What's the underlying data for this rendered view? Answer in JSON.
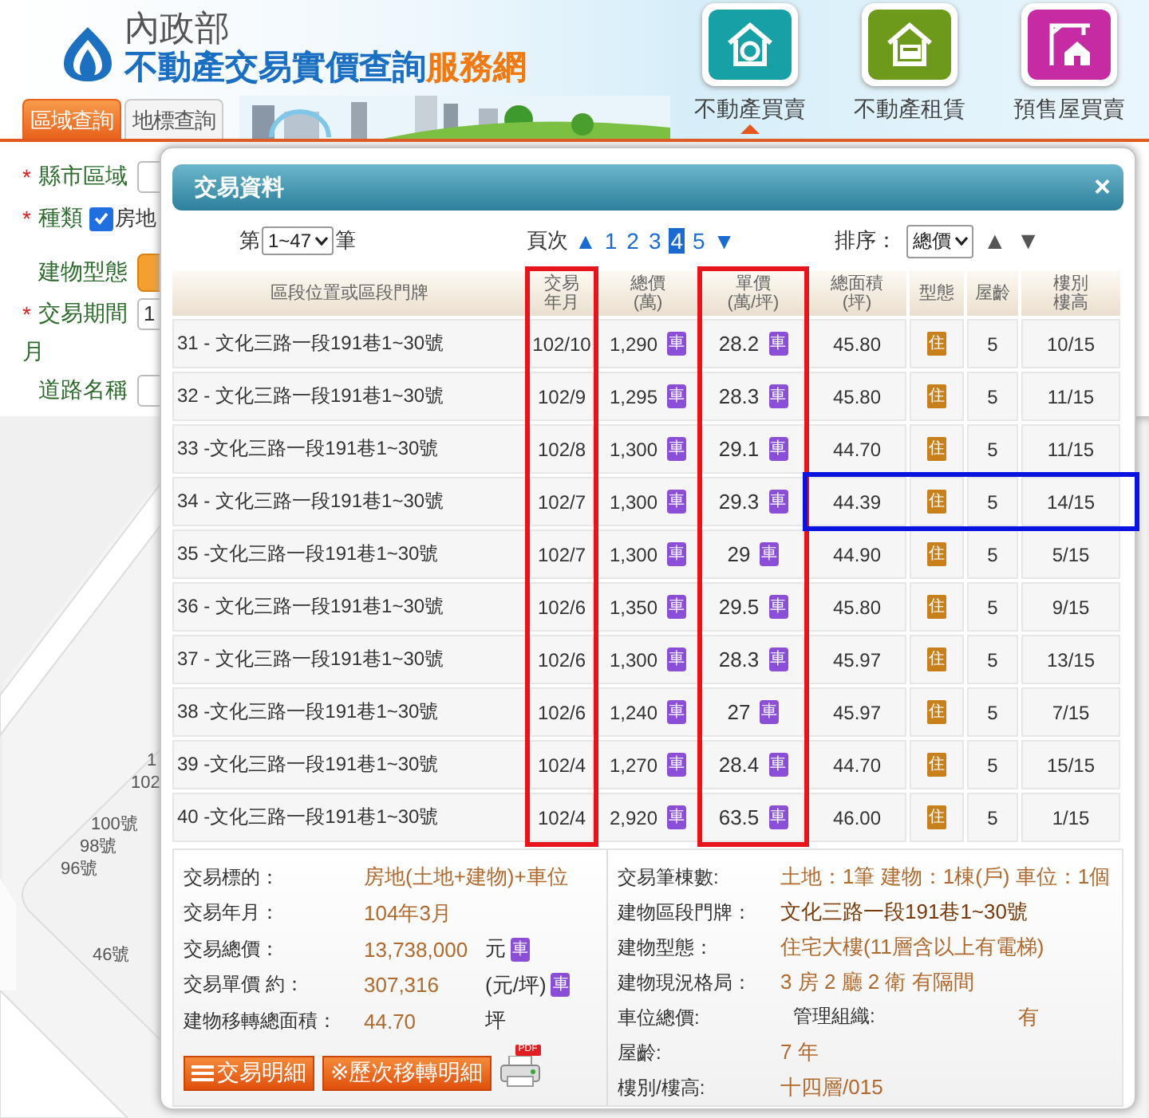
{
  "header": {
    "ministry": "內政部",
    "title": "不動產交易實價查詢",
    "title_suffix": "服務網"
  },
  "search_tabs": [
    {
      "label": "區域查詢",
      "selected": true
    },
    {
      "label": "地標查詢",
      "selected": false
    }
  ],
  "categories": [
    {
      "label": "不動產買賣",
      "kind": "sale",
      "selected": true
    },
    {
      "label": "不動產租賃",
      "kind": "rent",
      "selected": false
    },
    {
      "label": "預售屋買賣",
      "kind": "presale",
      "selected": false
    }
  ],
  "form": [
    {
      "kind": "select",
      "marker": "*",
      "label": "縣市區域"
    },
    {
      "kind": "checkbox",
      "marker": "*",
      "label": "種類",
      "checked": true,
      "option": "房地"
    },
    {
      "kind": "button",
      "label": "建物型態"
    },
    {
      "kind": "input",
      "marker": "*",
      "label": "交易期間",
      "value": "1"
    },
    {
      "kind": "text",
      "label": "月"
    },
    {
      "kind": "input",
      "label": "道路名稱"
    }
  ],
  "map": {
    "labels": [
      "1",
      "102",
      "100號",
      "98號",
      "96號",
      "46號"
    ]
  },
  "dialog": {
    "title": "交易資料",
    "close": "×",
    "range": {
      "prefix": "第",
      "value": "1~47",
      "suffix": "筆"
    },
    "pager": {
      "label": "頁次",
      "prev": "▲",
      "next": "▼",
      "pages": [
        {
          "label": "1",
          "selected": false
        },
        {
          "label": "2",
          "selected": false
        },
        {
          "label": "3",
          "selected": false
        },
        {
          "label": "4",
          "selected": true
        },
        {
          "label": "5",
          "selected": false
        }
      ]
    },
    "sort": {
      "label": "排序：",
      "value": "總價",
      "asc": "▲",
      "desc": "▼"
    },
    "table": {
      "columns": [
        {
          "lines": [
            "區段位置或區段門牌"
          ]
        },
        {
          "lines": [
            "交易",
            "年月"
          ],
          "color": "#e8141c"
        },
        {
          "lines": [
            "總價",
            "(萬)"
          ]
        },
        {
          "lines": [
            "單價",
            "(萬/坪)"
          ],
          "color": "#e8141c"
        },
        {
          "lines": [
            "總面積",
            "(坪)"
          ]
        },
        {
          "lines": [
            "型態"
          ]
        },
        {
          "lines": [
            "屋齡"
          ]
        },
        {
          "lines": [
            "樓別",
            "樓高"
          ]
        }
      ],
      "rows": [
        {
          "address": "31 - 文化三路一段191巷1~30號",
          "month": "102/10",
          "total": "1,290",
          "total_tag": "車",
          "unit": "28.2",
          "unit_tag": "車",
          "area": "45.80",
          "type": "住",
          "age": "5",
          "floor": "10/15"
        },
        {
          "address": "32 - 文化三路一段191巷1~30號",
          "month": "102/9",
          "total": "1,295",
          "total_tag": "車",
          "unit": "28.3",
          "unit_tag": "車",
          "area": "45.80",
          "type": "住",
          "age": "5",
          "floor": "11/15"
        },
        {
          "address": "33 -文化三路一段191巷1~30號",
          "month": "102/8",
          "total": "1,300",
          "total_tag": "車",
          "unit": "29.1",
          "unit_tag": "車",
          "area": "44.70",
          "type": "住",
          "age": "5",
          "floor": "11/15"
        },
        {
          "address": "34 - 文化三路一段191巷1~30號",
          "month": "102/7",
          "total": "1,300",
          "total_tag": "車",
          "unit": "29.3",
          "unit_tag": "車",
          "area": "44.39",
          "type": "住",
          "age": "5",
          "floor": "14/15",
          "color": "#0a14e0"
        },
        {
          "address": "35 -文化三路一段191巷1~30號",
          "month": "102/7",
          "total": "1,300",
          "total_tag": "車",
          "unit": "29",
          "unit_tag": "車",
          "area": "44.90",
          "type": "住",
          "age": "5",
          "floor": "5/15"
        },
        {
          "address": "36 - 文化三路一段191巷1~30號",
          "month": "102/6",
          "total": "1,350",
          "total_tag": "車",
          "unit": "29.5",
          "unit_tag": "車",
          "area": "45.80",
          "type": "住",
          "age": "5",
          "floor": "9/15"
        },
        {
          "address": "37 - 文化三路一段191巷1~30號",
          "month": "102/6",
          "total": "1,300",
          "total_tag": "車",
          "unit": "28.3",
          "unit_tag": "車",
          "area": "45.97",
          "type": "住",
          "age": "5",
          "floor": "13/15"
        },
        {
          "address": "38 -文化三路一段191巷1~30號",
          "month": "102/6",
          "total": "1,240",
          "total_tag": "車",
          "unit": "27",
          "unit_tag": "車",
          "area": "45.97",
          "type": "住",
          "age": "5",
          "floor": "7/15"
        },
        {
          "address": "39 -文化三路一段191巷1~30號",
          "month": "102/4",
          "total": "1,270",
          "total_tag": "車",
          "unit": "28.4",
          "unit_tag": "車",
          "area": "44.70",
          "type": "住",
          "age": "5",
          "floor": "15/15"
        },
        {
          "address": "40 -文化三路一段191巷1~30號",
          "month": "102/4",
          "total": "2,920",
          "total_tag": "車",
          "unit": "63.5",
          "unit_tag": "車",
          "area": "46.00",
          "type": "住",
          "age": "5",
          "floor": "1/15"
        }
      ]
    },
    "details": {
      "left": [
        {
          "label": "交易標的：",
          "value": "房地(土地+建物)+車位"
        },
        {
          "label": "交易年月：",
          "value": "104年3月"
        },
        {
          "label": "交易總價：",
          "value": "13,738,000",
          "unit": "元",
          "tag": "車"
        },
        {
          "label": "交易單價 約：",
          "value": "307,316",
          "unit": "(元/坪)",
          "tag": "車"
        },
        {
          "label": "建物移轉總面積：",
          "value": "44.70",
          "unit": "坪"
        }
      ],
      "right": [
        {
          "label": "交易筆棟數:",
          "value": "土地：1筆 建物：1棟(戶) 車位：1個"
        },
        {
          "label": "建物區段門牌：",
          "value": "文化三路一段191巷1~30號",
          "emphasis": true
        },
        {
          "label": "建物型態：",
          "value": "住宅大樓(11層含以上有電梯)"
        },
        {
          "label": "建物現況格局：",
          "value": "3 房 2 廳 2 衛 有隔間"
        },
        {
          "label": "車位總價:",
          "sub_label": "管理組織:",
          "value": "有"
        },
        {
          "label": "屋齡:",
          "value": "7  年"
        },
        {
          "label": "樓別/樓高:",
          "value": "十四層/015"
        }
      ],
      "buttons": [
        {
          "label": "交易明細",
          "kind": "list"
        },
        {
          "label": "※歷次移轉明細",
          "kind": "plain"
        }
      ],
      "print": {
        "tag": "PDF"
      }
    }
  }
}
